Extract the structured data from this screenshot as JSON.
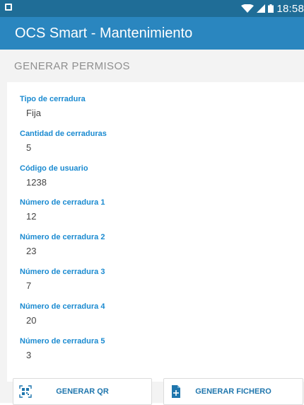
{
  "status_bar": {
    "time": "18:58"
  },
  "app_bar": {
    "title": "OCS Smart - Mantenimiento"
  },
  "section": {
    "title": "GENERAR PERMISOS"
  },
  "fields": [
    {
      "label": "Tipo de cerradura",
      "value": "Fija"
    },
    {
      "label": "Cantidad de cerraduras",
      "value": "5"
    },
    {
      "label": "Código de usuario",
      "value": "1238"
    },
    {
      "label": "Número de cerradura 1",
      "value": "12"
    },
    {
      "label": "Número de cerradura 2",
      "value": "23"
    },
    {
      "label": "Número de cerradura 3",
      "value": "7"
    },
    {
      "label": "Número de cerradura 4",
      "value": "20"
    },
    {
      "label": "Número de cerradura 5",
      "value": "3"
    }
  ],
  "actions": {
    "qr_label": "GENERAR QR",
    "file_label": "GENERAR FICHERO"
  },
  "icons": {
    "status_left": "notification-icon",
    "wifi": "wifi-icon",
    "signal": "signal-icon",
    "battery": "battery-icon",
    "qr": "qr-code-icon",
    "file": "add-file-icon"
  },
  "colors": {
    "status_bar": "#1f6d97",
    "app_bar": "#2a86bf",
    "label_accent": "#1a8ad0",
    "button_text": "#1f76ad"
  }
}
